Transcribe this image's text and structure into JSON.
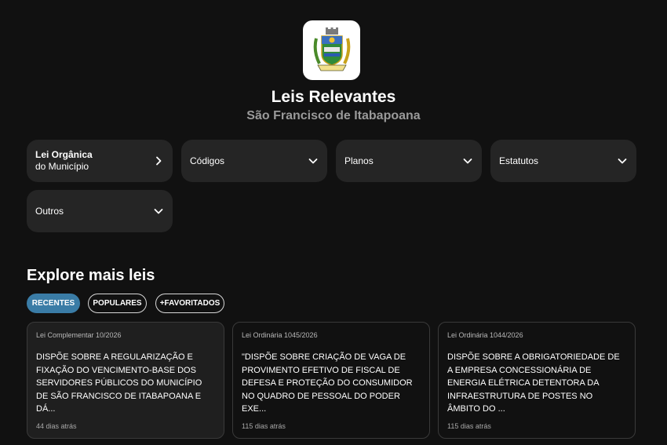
{
  "header": {
    "logo_icon": "municipal-coat-of-arms",
    "title": "Leis Relevantes",
    "subtitle": "São Francisco de Itabapoana"
  },
  "categories": [
    {
      "line1": "Lei Orgânica",
      "line2": "do Município",
      "icon": "chevron-right-icon"
    },
    {
      "line1": "Códigos",
      "line2": "",
      "icon": "chevron-down-icon"
    },
    {
      "line1": "Planos",
      "line2": "",
      "icon": "chevron-down-icon"
    },
    {
      "line1": "Estatutos",
      "line2": "",
      "icon": "chevron-down-icon"
    },
    {
      "line1": "Outros",
      "line2": "",
      "icon": "chevron-down-icon"
    }
  ],
  "explore": {
    "title": "Explore mais leis",
    "tabs": [
      {
        "label": "RECENTES",
        "active": true
      },
      {
        "label": "POPULARES",
        "active": false
      },
      {
        "label": "+FAVORITADOS",
        "active": false
      }
    ],
    "accent_color": "#3a7ca6"
  },
  "laws": [
    {
      "type": "Lei Complementar 10/2026",
      "text": "DISPÕE SOBRE A REGULARIZAÇÃO E FIXAÇÃO DO VENCIMENTO-BASE DOS SERVIDORES PÚBLICOS DO MUNICÍPIO DE SÃO FRANCISCO DE ITABAPOANA E DÁ...",
      "age": "44 dias atrás"
    },
    {
      "type": "Lei Ordinária 1045/2026",
      "text": "\"DISPÕE SOBRE CRIAÇÃO DE VAGA DE PROVIMENTO EFETIVO DE FISCAL DE DEFESA E PROTEÇÃO DO CONSUMIDOR NO QUADRO DE PESSOAL DO PODER EXE...",
      "age": "115 dias atrás"
    },
    {
      "type": "Lei Ordinária 1044/2026",
      "text": "DISPÕE SOBRE A OBRIGATORIEDADE DE A EMPRESA CONCESSIONÁRIA DE ENERGIA ELÉTRICA DETENTORA DA INFRAESTRUTURA DE POSTES NO ÂMBITO DO ...",
      "age": "115 dias atrás"
    }
  ]
}
